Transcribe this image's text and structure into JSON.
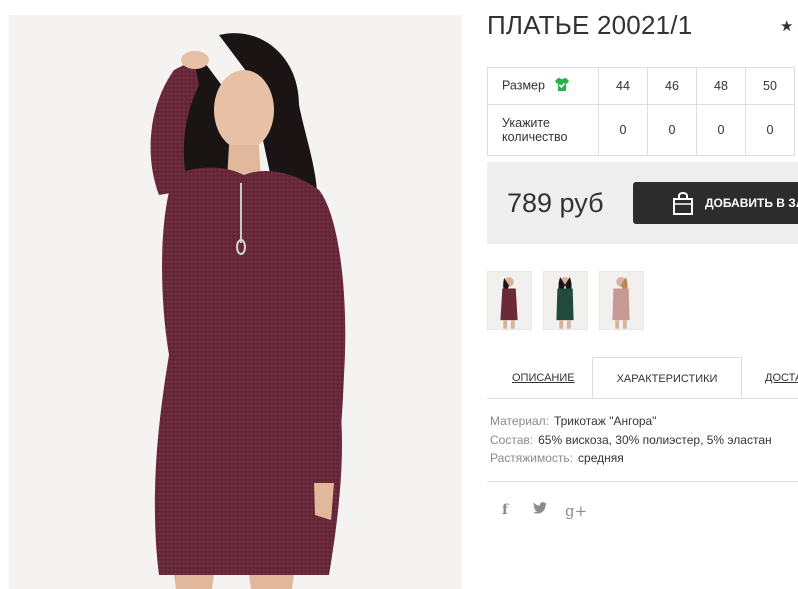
{
  "product": {
    "title": "ПЛАТЬЕ 20021/1",
    "price": "789 руб",
    "add_to_cart_label": "ДОБАВИТЬ В ЗАКАЗ"
  },
  "sizes": {
    "size_label": "Размер",
    "quantity_label_line1": "Укажите",
    "quantity_label_line2": "количество",
    "options": [
      {
        "size": "44",
        "qty": "0"
      },
      {
        "size": "46",
        "qty": "0"
      },
      {
        "size": "48",
        "qty": "0"
      },
      {
        "size": "50",
        "qty": "0"
      }
    ]
  },
  "thumbnails": [
    {
      "icon": "dress-thumbnail-burgundy",
      "color": "#6a2a3a"
    },
    {
      "icon": "dress-thumbnail-green",
      "color": "#1f4a3c"
    },
    {
      "icon": "dress-thumbnail-pink",
      "color": "#c79a94"
    }
  ],
  "tabs": {
    "description": "ОПИСАНИЕ",
    "specs": "ХАРАКТЕРИСТИКИ",
    "delivery": "ДОСТАВКА"
  },
  "specs": [
    {
      "key": "Материал:",
      "value": "Трикотаж \"Ангора\""
    },
    {
      "key": "Состав:",
      "value": "65% вискоза, 30% полиэстер, 5% эластан"
    },
    {
      "key": "Растяжимость:",
      "value": "средняя"
    }
  ],
  "social": {
    "facebook": "f",
    "twitter": "t",
    "googleplus": "g+"
  },
  "colors": {
    "dress": "#6b2a3c",
    "button": "#2c2c2c",
    "price_bg": "#efefef",
    "size_icon": "#2db24a"
  }
}
